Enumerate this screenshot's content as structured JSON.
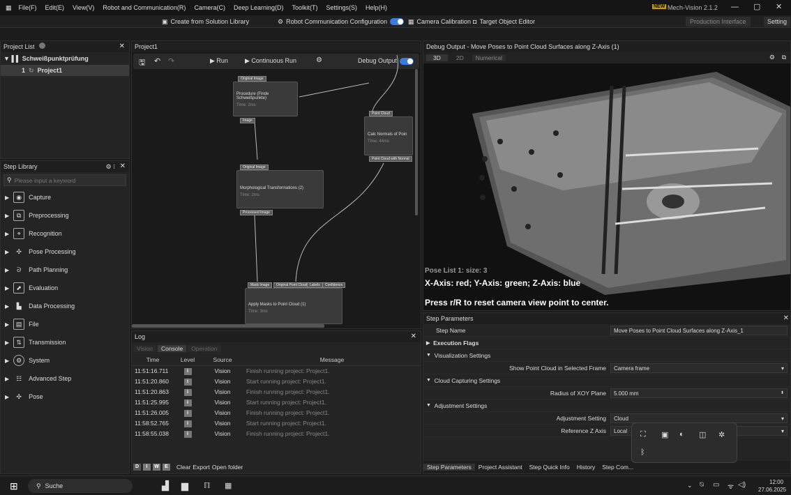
{
  "menu": {
    "items": [
      "File(F)",
      "Edit(E)",
      "View(V)",
      "Robot and Communication(R)",
      "Camera(C)",
      "Deep Learning(D)",
      "Toolkit(T)",
      "Settings(S)",
      "Help(H)"
    ],
    "new_badge": "NEW",
    "version": "Mech-Vision 2.1.2"
  },
  "toolbar": {
    "create_solution": "Create from Solution Library",
    "robot_comm": "Robot Communication Configuration",
    "camera_calib": "Camera Calibration",
    "target_editor": "Target Object Editor",
    "production": "Production Interface",
    "settings": "Setting"
  },
  "project_list": {
    "title": "Project List",
    "group": "Schweißpunktprüfung",
    "project_index": "1",
    "project_name": "Project1"
  },
  "step_library": {
    "title": "Step Library",
    "search_placeholder": "Please input a keyword",
    "items": [
      "Capture",
      "Preprocessing",
      "Recognition",
      "Pose Processing",
      "Path Planning",
      "Evaluation",
      "Data Processing",
      "File",
      "Transmission",
      "System",
      "Advanced Step",
      "Pose"
    ]
  },
  "canvas": {
    "title": "Project1",
    "run": "Run",
    "continuous_run": "Continuous Run",
    "debug_output": "Debug Output",
    "nodes": [
      {
        "title": "Procedure (Finde Schweißpunkte)",
        "sub": "Time: 2ms",
        "in": "Original Image",
        "out": "Image"
      },
      {
        "title": "Calc Normals of Poin",
        "sub": "Time: 44ms",
        "in": "Point Cloud",
        "out": "Point Cloud with Normal"
      },
      {
        "title": "Morphological Transformations (2)",
        "sub": "Time: 2ms",
        "in": "Original Image",
        "out": "Processed Image"
      },
      {
        "title": "Apply Masks to Point Cloud (1)",
        "sub": "Time: 3ms",
        "in1": "Mask Image",
        "in2": "Original Point Cloud",
        "in3": "Labels",
        "in4": "Confidence"
      }
    ]
  },
  "log": {
    "title": "Log",
    "tabs": [
      "Vision",
      "Console",
      "Operation"
    ],
    "headers": [
      "Time",
      "Level",
      "Source",
      "Message"
    ],
    "rows": [
      {
        "time": "11:51:16.711",
        "level": "i",
        "source": "Vision",
        "message": "Finish running project: Project1."
      },
      {
        "time": "11:51:20.860",
        "level": "i",
        "source": "Vision",
        "message": "Start running project: Project1."
      },
      {
        "time": "11:51:20.863",
        "level": "i",
        "source": "Vision",
        "message": "Finish running project: Project1."
      },
      {
        "time": "11:51:25.995",
        "level": "i",
        "source": "Vision",
        "message": "Start running project: Project1."
      },
      {
        "time": "11:51:26.005",
        "level": "i",
        "source": "Vision",
        "message": "Finish running project: Project1."
      },
      {
        "time": "11:58:52.765",
        "level": "i",
        "source": "Vision",
        "message": "Start running project: Project1."
      },
      {
        "time": "11:58:55.038",
        "level": "i",
        "source": "Vision",
        "message": "Finish running project: Project1."
      }
    ],
    "filters": [
      "D",
      "I",
      "W",
      "E"
    ],
    "clear": "Clear",
    "export": "Export",
    "open_folder": "Open folder"
  },
  "debug": {
    "title": "Debug Output - Move Poses to Point Cloud Surfaces along Z-Axis (1)",
    "tabs": [
      "3D",
      "2D",
      "Numerical"
    ],
    "pose_list": "Pose List 1: size: 3",
    "axes_legend": "X-Axis: red; Y-Axis: green; Z-Axis: blue",
    "reset_hint": "Press r/R to reset camera view point to center."
  },
  "step_params": {
    "title": "Step Parameters",
    "step_name_label": "Step Name",
    "step_name_value": "Move Poses to Point Cloud Surfaces along Z-Axis_1",
    "execution_flags": "Execution Flags",
    "visualization_settings": "Visualization Settings",
    "show_pc_label": "Show Point Cloud in Selected Frame",
    "show_pc_value": "Camera frame",
    "cloud_capturing": "Cloud Capturing Settings",
    "radius_label": "Radius of XOY Plane",
    "radius_value": "5.000 mm",
    "adjustment_settings": "Adjustment Settings",
    "adj_setting_label": "Adjustment Setting",
    "adj_setting_value": "Cloud",
    "ref_z_label": "Reference Z Axis",
    "ref_z_value": "Local",
    "bottom_tabs": [
      "Step Parameters",
      "Project Assistant",
      "Step Quick Info",
      "History",
      "Step Com..."
    ]
  },
  "taskbar": {
    "search": "Suche",
    "time": "12:00",
    "date": "27.06.2025"
  }
}
